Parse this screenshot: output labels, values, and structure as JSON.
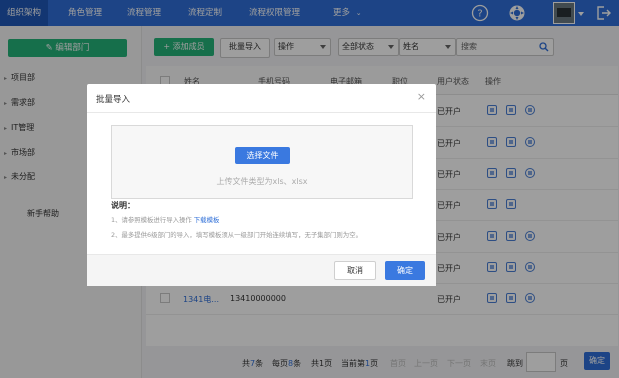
{
  "nav": {
    "tabs": [
      "组织架构",
      "角色管理",
      "流程管理",
      "流程定制",
      "流程权限管理"
    ],
    "more": "更多"
  },
  "sidebar": {
    "edit_dept": "编辑部门",
    "departments": [
      "项目部",
      "需求部",
      "IT管理",
      "市场部",
      "未分配"
    ],
    "help": "新手帮助"
  },
  "toolbar": {
    "add_member": "添加成员",
    "batch_import": "批量导入",
    "operation": "操作",
    "status_filter": "全部状态",
    "name_filter": "姓名",
    "search_placeholder": "搜索"
  },
  "table": {
    "headers": [
      "姓名",
      "手机号码",
      "电子邮箱",
      "职位",
      "用户状态",
      "操作"
    ],
    "status_values": [
      "已开户",
      "已开户",
      "已开户",
      "已开户",
      "已开户",
      "已开户",
      "已开户"
    ],
    "last_row": {
      "name": "1341电...",
      "phone": "13410000000"
    }
  },
  "pager": {
    "total_prefix": "共",
    "total_count": "7",
    "total_suffix": "条",
    "per_page_prefix": "每页",
    "per_page": "8",
    "per_page_suffix": "条",
    "pages": "共1页",
    "current_prefix": "当前第",
    "current": "1",
    "current_suffix": "页",
    "first": "首页",
    "prev": "上一页",
    "next": "下一页",
    "last": "末页",
    "jump": "跳到",
    "page_unit": "页",
    "go": "确定"
  },
  "modal": {
    "title": "批量导入",
    "choose_file": "选择文件",
    "hint": "上传文件类型为xls、xlsx",
    "notes_title": "说明：",
    "note1_prefix": "1、请参照模板进行导入操作 ",
    "note1_link": "下载模板",
    "note2": "2、最多提供6级部门的导入，填写模板须从一级部门开始连续填写，无子集部门则为空。",
    "cancel": "取消",
    "confirm": "确定"
  }
}
